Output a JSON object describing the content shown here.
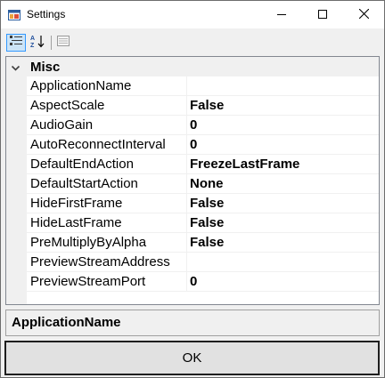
{
  "window": {
    "title": "Settings",
    "app_icon": "app-window-icon",
    "caption_buttons": [
      "minimize-icon",
      "maximize-icon",
      "close-icon"
    ]
  },
  "toolbar": {
    "buttons": [
      "categorized-icon",
      "alphabetical-icon",
      "property-pages-icon"
    ],
    "selected": "categorized"
  },
  "grid": {
    "category": "Misc",
    "category_expanded": true,
    "properties": [
      {
        "name": "ApplicationName",
        "value": ""
      },
      {
        "name": "AspectScale",
        "value": "False"
      },
      {
        "name": "AudioGain",
        "value": "0"
      },
      {
        "name": "AutoReconnectInterval",
        "value": "0"
      },
      {
        "name": "DefaultEndAction",
        "value": "FreezeLastFrame"
      },
      {
        "name": "DefaultStartAction",
        "value": "None"
      },
      {
        "name": "HideFirstFrame",
        "value": "False"
      },
      {
        "name": "HideLastFrame",
        "value": "False"
      },
      {
        "name": "PreMultiplyByAlpha",
        "value": "False"
      },
      {
        "name": "PreviewStreamAddress",
        "value": ""
      },
      {
        "name": "PreviewStreamPort",
        "value": "0"
      }
    ],
    "selected_property": "ApplicationName"
  },
  "help": {
    "title": "ApplicationName"
  },
  "ok_button": {
    "label": "OK"
  },
  "colors": {
    "selected_toolbar_border": "#3399ff",
    "selected_toolbar_fill": "#cce4f7",
    "grid_margin": "#f0f0f0"
  }
}
